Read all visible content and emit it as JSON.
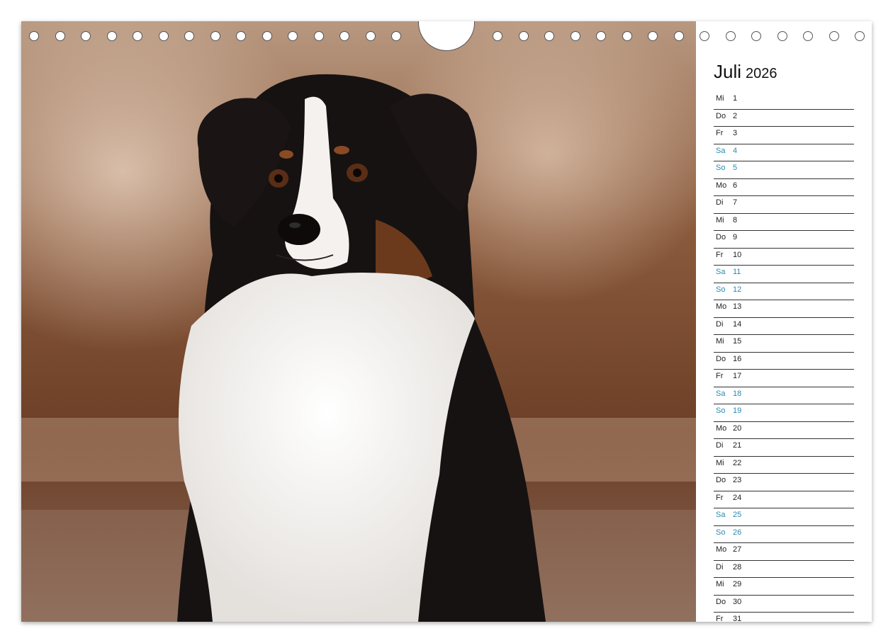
{
  "calendar": {
    "month": "Juli",
    "year": "2026",
    "weekend_color": "#2a8ab0",
    "photo_subject": "dog-portrait",
    "days": [
      {
        "wd": "Mi",
        "d": "1",
        "we": false
      },
      {
        "wd": "Do",
        "d": "2",
        "we": false
      },
      {
        "wd": "Fr",
        "d": "3",
        "we": false
      },
      {
        "wd": "Sa",
        "d": "4",
        "we": true
      },
      {
        "wd": "So",
        "d": "5",
        "we": true
      },
      {
        "wd": "Mo",
        "d": "6",
        "we": false
      },
      {
        "wd": "Di",
        "d": "7",
        "we": false
      },
      {
        "wd": "Mi",
        "d": "8",
        "we": false
      },
      {
        "wd": "Do",
        "d": "9",
        "we": false
      },
      {
        "wd": "Fr",
        "d": "10",
        "we": false
      },
      {
        "wd": "Sa",
        "d": "11",
        "we": true
      },
      {
        "wd": "So",
        "d": "12",
        "we": true
      },
      {
        "wd": "Mo",
        "d": "13",
        "we": false
      },
      {
        "wd": "Di",
        "d": "14",
        "we": false
      },
      {
        "wd": "Mi",
        "d": "15",
        "we": false
      },
      {
        "wd": "Do",
        "d": "16",
        "we": false
      },
      {
        "wd": "Fr",
        "d": "17",
        "we": false
      },
      {
        "wd": "Sa",
        "d": "18",
        "we": true
      },
      {
        "wd": "So",
        "d": "19",
        "we": true
      },
      {
        "wd": "Mo",
        "d": "20",
        "we": false
      },
      {
        "wd": "Di",
        "d": "21",
        "we": false
      },
      {
        "wd": "Mi",
        "d": "22",
        "we": false
      },
      {
        "wd": "Do",
        "d": "23",
        "we": false
      },
      {
        "wd": "Fr",
        "d": "24",
        "we": false
      },
      {
        "wd": "Sa",
        "d": "25",
        "we": true
      },
      {
        "wd": "So",
        "d": "26",
        "we": true
      },
      {
        "wd": "Mo",
        "d": "27",
        "we": false
      },
      {
        "wd": "Di",
        "d": "28",
        "we": false
      },
      {
        "wd": "Mi",
        "d": "29",
        "we": false
      },
      {
        "wd": "Do",
        "d": "30",
        "we": false
      },
      {
        "wd": "Fr",
        "d": "31",
        "we": false
      }
    ]
  }
}
